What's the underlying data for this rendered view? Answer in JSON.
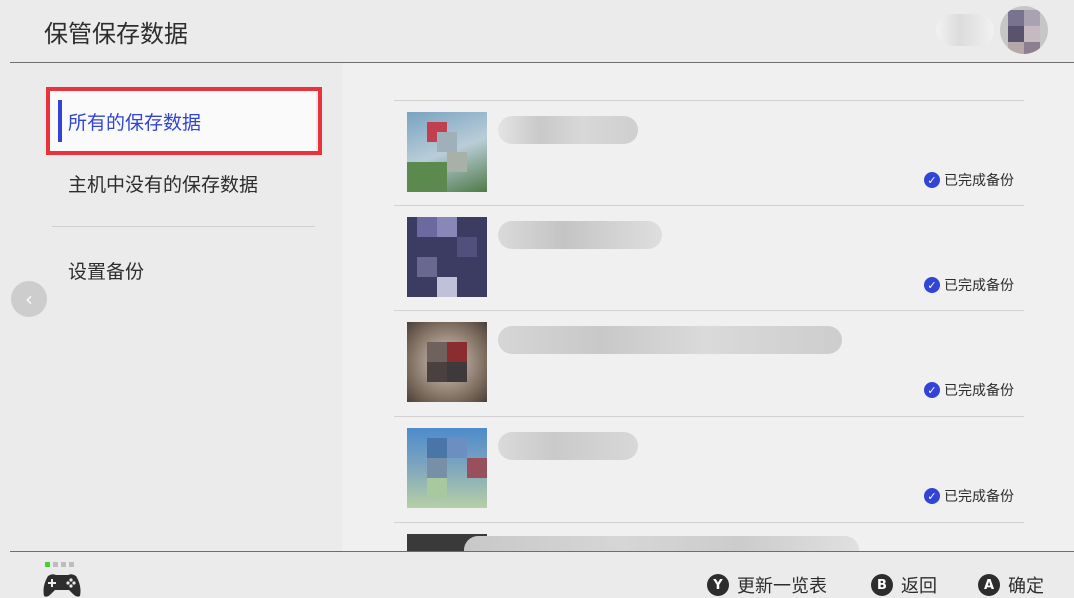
{
  "header": {
    "title": "保管保存数据"
  },
  "sidebar": {
    "items": [
      {
        "label": "所有的保存数据",
        "selected": true
      },
      {
        "label": "主机中没有的保存数据",
        "selected": false
      },
      {
        "label": "设置备份",
        "selected": false
      }
    ]
  },
  "save_list": {
    "items": [
      {
        "status": "已完成备份"
      },
      {
        "status": "已完成备份"
      },
      {
        "status": "已完成备份"
      },
      {
        "status": "已完成备份"
      },
      {
        "status": ""
      }
    ]
  },
  "footer": {
    "buttons": [
      {
        "glyph": "Y",
        "label": "更新一览表"
      },
      {
        "glyph": "B",
        "label": "返回"
      },
      {
        "glyph": "A",
        "label": "确定"
      }
    ]
  },
  "colors": {
    "accent": "#3144d6",
    "highlight_box": "#e8323c",
    "battery_green": "#4ccf2a"
  },
  "icons": {
    "check": "check-circle-icon",
    "back": "chevron-left-icon",
    "controller": "controller-icon"
  }
}
